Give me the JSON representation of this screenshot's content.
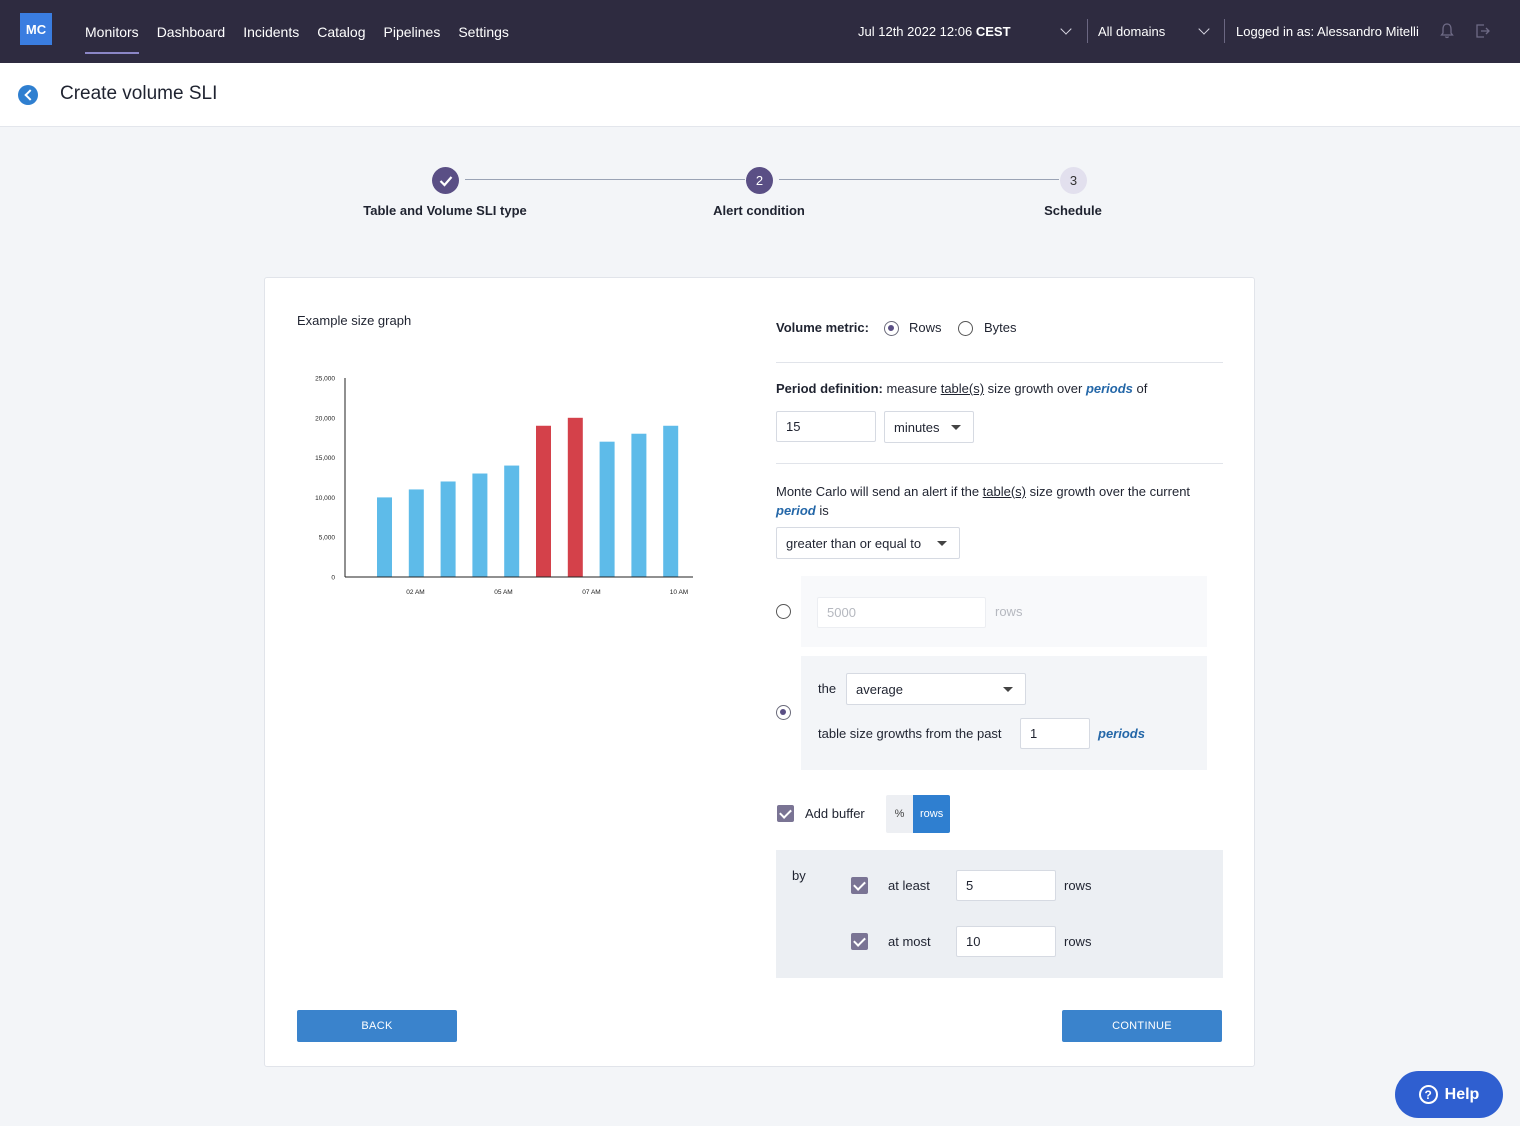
{
  "nav": {
    "logo": "MC",
    "links": [
      "Monitors",
      "Dashboard",
      "Incidents",
      "Catalog",
      "Pipelines",
      "Settings"
    ],
    "date_prefix": "Jul 12th 2022 12:06",
    "date_tz": "CEST",
    "domains": "All domains",
    "user": "Logged in as: Alessandro Mitelli"
  },
  "page": {
    "title": "Create volume SLI"
  },
  "stepper": {
    "steps": [
      {
        "label": "Table and Volume SLI type",
        "state": "done"
      },
      {
        "label": "Alert condition",
        "number": "2",
        "state": "active"
      },
      {
        "label": "Schedule",
        "number": "3",
        "state": "todo"
      }
    ]
  },
  "graph": {
    "title": "Example size graph"
  },
  "chart_data": {
    "type": "bar",
    "title": "",
    "xlabel": "",
    "ylabel": "",
    "ylim": [
      0,
      25000
    ],
    "yticks": [
      "0",
      "5,000",
      "10,000",
      "15,000",
      "20,000",
      "25,000"
    ],
    "xticks": [
      "02 AM",
      "05 AM",
      "07 AM",
      "10 AM"
    ],
    "values": [
      10000,
      11000,
      12000,
      13000,
      14000,
      19000,
      20000,
      17000,
      18000,
      19000
    ],
    "colors": [
      "#5ebbe9",
      "#5ebbe9",
      "#5ebbe9",
      "#5ebbe9",
      "#5ebbe9",
      "#d4414a",
      "#d4414a",
      "#5ebbe9",
      "#5ebbe9",
      "#5ebbe9"
    ]
  },
  "form": {
    "volume_metric_label": "Volume metric:",
    "metric_options": [
      "Rows",
      "Bytes"
    ],
    "metric_selected": "Rows",
    "period_def_bold": "Period definition:",
    "period_def_text1": " measure ",
    "period_def_tables": "table(s)",
    "period_def_text2": " size growth over ",
    "period_def_periods": "periods",
    "period_def_text3": " of",
    "period_value": "15",
    "period_unit": "minutes",
    "alert_text1": "Monte Carlo will send an alert if the ",
    "alert_tables": "table(s)",
    "alert_text2": " size growth over the current",
    "alert_period": "period",
    "alert_is": " is",
    "comparator": "greater than or equal to",
    "absolute_placeholder": "5000",
    "absolute_unit": "rows",
    "the_label": "the",
    "aggregate": "average",
    "past_label": "table size growths from the past",
    "past_value": "1",
    "past_unit": "periods",
    "buffer_label": "Add buffer",
    "buffer_options": [
      "%",
      "rows"
    ],
    "by_label": "by",
    "at_least_label": "at least",
    "at_least_value": "5",
    "at_least_unit": "rows",
    "at_most_label": "at most",
    "at_most_value": "10",
    "at_most_unit": "rows"
  },
  "buttons": {
    "back": "BACK",
    "continue": "CONTINUE",
    "help": "Help"
  }
}
